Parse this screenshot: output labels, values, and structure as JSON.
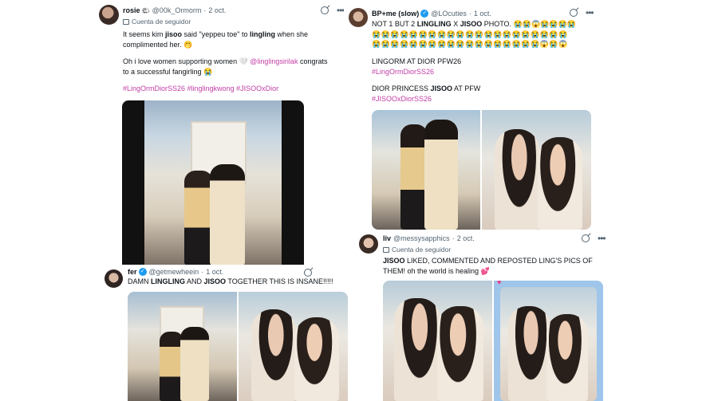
{
  "tweets": {
    "rosie": {
      "name": "rosie",
      "name_emoji": "🌤",
      "handle": "@00k_Ormorm",
      "date": "2 oct.",
      "follow_label": "Cuenta de seguidor",
      "line1_a": "It seems kim ",
      "line1_b": "jisoo",
      "line1_c": " said \"yeppeu toe\" to ",
      "line1_d": "lingling",
      "line1_e": " when she",
      "line2": "complimented her. 🤭",
      "line3_a": "Oh i love women supporting women 🤍 ",
      "line3_b": "@linglingsirilak",
      "line3_c": " congrats",
      "line4": "to a successful fangirling 😭",
      "hashtags": "#LingOrmDiorSS26 #linglingkwong #JISOOxDior"
    },
    "bp": {
      "name": "BP+me (slow)",
      "handle": "@LOcuties",
      "date": "1 oct.",
      "line1_a": "NOT 1 BUT 2 ",
      "line1_b": "LINGLING",
      "line1_c": " X ",
      "line1_d": "JISOO",
      "line1_e": " PHOTO. 😭😭😱😭😭😭😭",
      "emoji_row1": "😭😭😭😭😭😭😭😭😭😭😭😭😭😭😭😭😭😭😭😭😭",
      "emoji_row2": "😭😭😭😭😭😭😭😭😭😭😭😭😭😭😭😭😭😭😱😭😱",
      "line2": "LINGORM AT DIOR PFW26",
      "tag1": "#LingOrmDiorSS26",
      "line3_a": "DIOR PRINCESS ",
      "line3_b": "JISOO",
      "line3_c": " AT PFW",
      "tag2": "#JISOOxDiorSS26"
    },
    "fer": {
      "name": "fer",
      "handle": "@getmewheein",
      "date": "1 oct.",
      "line1_a": "DAMN ",
      "line1_b": "LINGLING",
      "line1_c": " AND ",
      "line1_d": "JISOO",
      "line1_e": " TOGETHER THIS IS INSANE!!!!!"
    },
    "liv": {
      "name": "liv",
      "handle": "@messysapphics",
      "date": "2 oct.",
      "follow_label": "Cuenta de seguidor",
      "line1_a": "JISOO",
      "line1_b": " LIKED, COMMENTED AND REPOSTED LING'S PICS OF",
      "line2": "THEM! oh the world is healing 💕"
    }
  },
  "colors": {
    "accent": "#c23ea6",
    "verified": "#1d9bf0",
    "muted": "#536471"
  }
}
